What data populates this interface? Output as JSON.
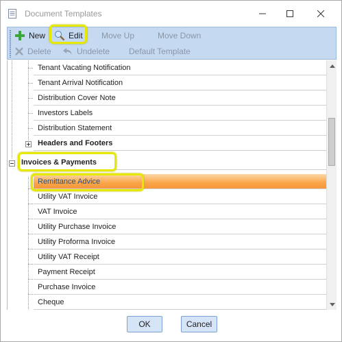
{
  "window": {
    "title": "Document Templates",
    "controls": {
      "minimize": "minimize",
      "maximize": "maximize",
      "close": "close"
    }
  },
  "toolbar": {
    "new_label": "New",
    "edit_label": "Edit",
    "move_up_label": "Move Up",
    "move_down_label": "Move Down",
    "delete_label": "Delete",
    "undelete_label": "Undelete",
    "default_template_label": "Default Template"
  },
  "tree": {
    "rows": [
      {
        "label": "Tenant Vacating Notification"
      },
      {
        "label": "Tenant Arrival Notification"
      },
      {
        "label": "Distribution Cover Note"
      },
      {
        "label": "Investors Labels"
      },
      {
        "label": "Distribution Statement"
      },
      {
        "label": "Headers and Footers"
      },
      {
        "label": "Invoices & Payments"
      },
      {
        "label": "Remittance Advice"
      },
      {
        "label": "Utility VAT Invoice"
      },
      {
        "label": "VAT Invoice"
      },
      {
        "label": "Utility Purchase Invoice"
      },
      {
        "label": "Utility Proforma Invoice"
      },
      {
        "label": "Utility VAT Receipt"
      },
      {
        "label": "Payment Receipt"
      },
      {
        "label": "Purchase Invoice"
      },
      {
        "label": "Cheque"
      }
    ]
  },
  "buttons": {
    "ok": "OK",
    "cancel": "Cancel"
  },
  "colors": {
    "selection": "#f9a64a",
    "highlight": "#e6e800",
    "toolbar": "#c5d9f1"
  }
}
